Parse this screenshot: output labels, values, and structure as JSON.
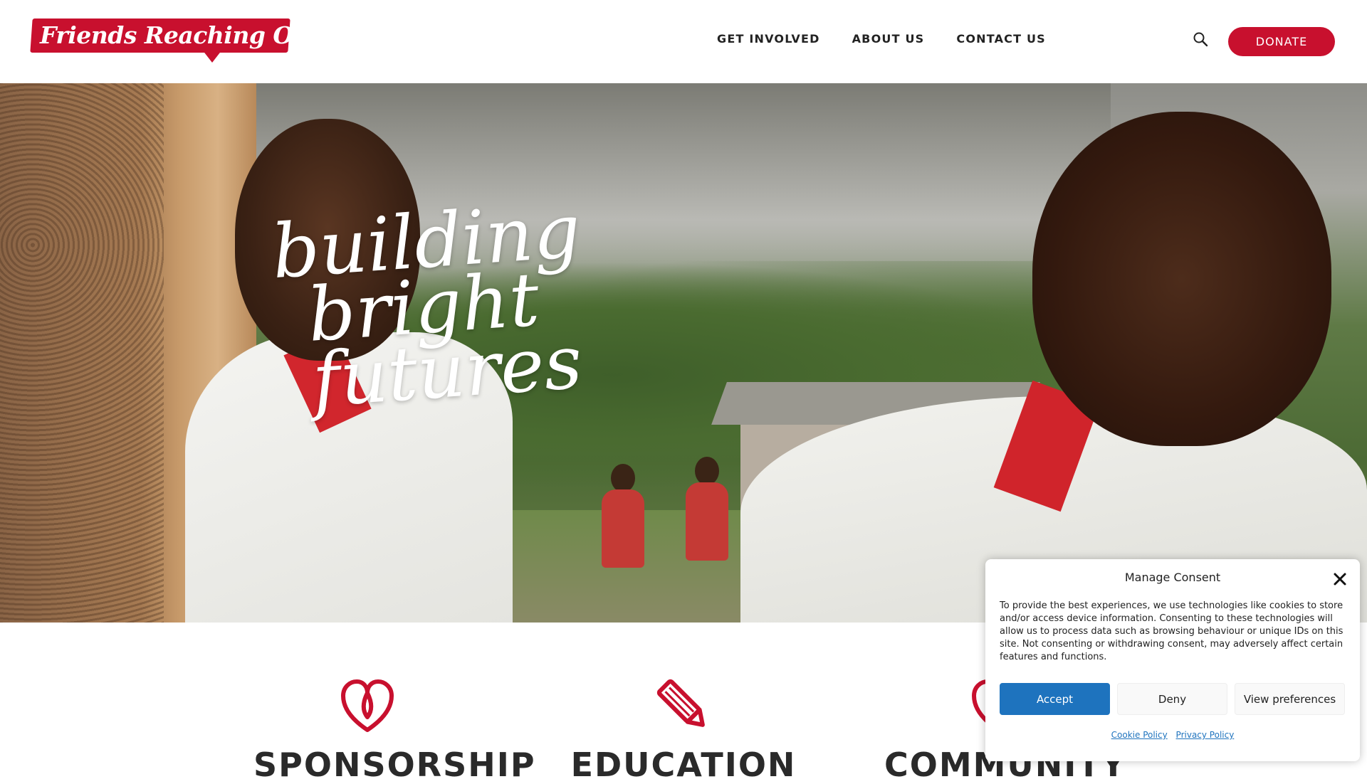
{
  "brand": {
    "logo_text": "Friends Reaching Out",
    "accent_color": "#c8102e"
  },
  "nav": {
    "items": [
      {
        "label": "GET INVOLVED"
      },
      {
        "label": "ABOUT US"
      },
      {
        "label": "CONTACT US"
      }
    ],
    "search_icon": "search-icon",
    "donate_label": "DONATE"
  },
  "hero": {
    "line1": "building",
    "line2": "bright futures"
  },
  "features": [
    {
      "title": "SPONSORSHIP",
      "icon": "heart-icon"
    },
    {
      "title": "EDUCATION",
      "icon": "pencil-icon"
    },
    {
      "title": "COMMUNITY",
      "icon": "heart-icon"
    }
  ],
  "consent": {
    "title": "Manage Consent",
    "body": "To provide the best experiences, we use technologies like cookies to store and/or access device information. Consenting to these technologies will allow us to process data such as browsing behaviour or unique IDs on this site. Not consenting or withdrawing consent, may adversely affect certain features and functions.",
    "accept_label": "Accept",
    "deny_label": "Deny",
    "prefs_label": "View preferences",
    "cookie_policy": "Cookie Policy",
    "privacy_policy": "Privacy Policy",
    "button_color": "#1e73be"
  }
}
